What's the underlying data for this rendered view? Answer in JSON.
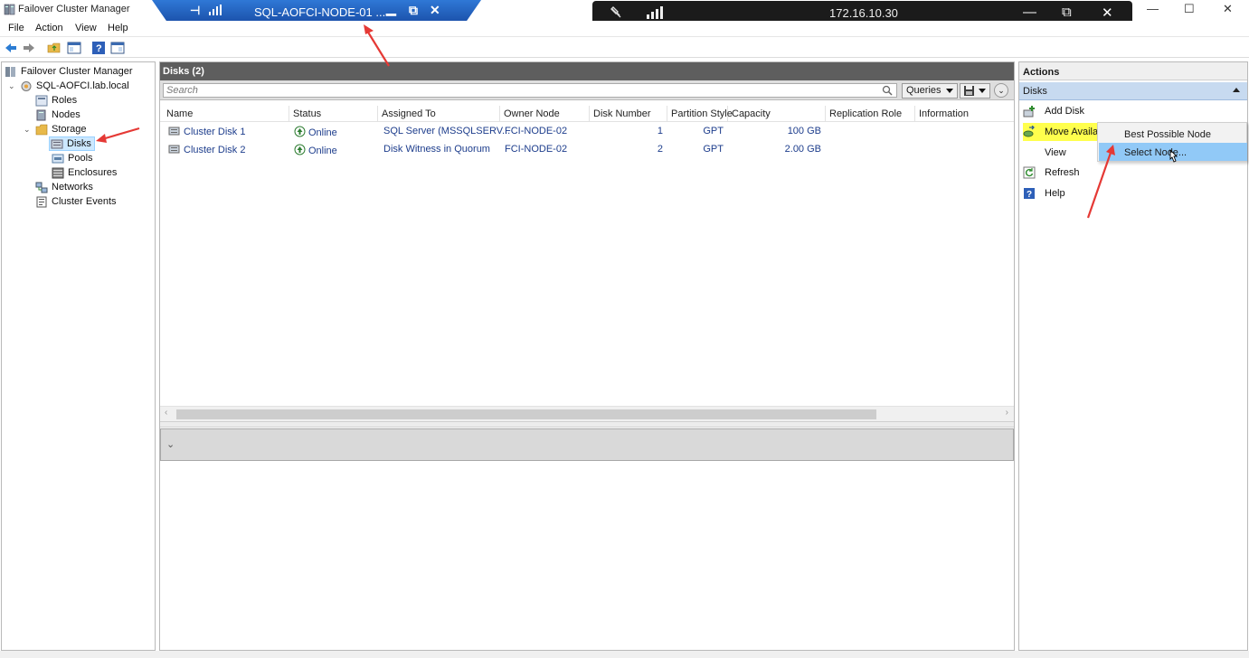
{
  "window": {
    "title": "Failover Cluster Manager",
    "controls": {
      "minimize": "—",
      "maximize": "☐",
      "close": "✕"
    }
  },
  "rdp_bar": {
    "title": "SQL-AOFCI-NODE-01 ...",
    "pin": "⊣",
    "controls": {
      "minimize": "▁",
      "restore": "⧉",
      "close": "✕"
    }
  },
  "remote_bar": {
    "address": "172.16.10.30",
    "controls": {
      "minimize": "—",
      "restore": "⧉",
      "close": "✕"
    }
  },
  "menu": {
    "items": [
      "File",
      "Action",
      "View",
      "Help"
    ]
  },
  "tree": {
    "root": "Failover Cluster Manager",
    "cluster": "SQL-AOFCI.lab.local",
    "roles": "Roles",
    "nodes": "Nodes",
    "storage": "Storage",
    "disks": "Disks",
    "pools": "Pools",
    "enclosures": "Enclosures",
    "networks": "Networks",
    "cluster_events": "Cluster Events"
  },
  "center": {
    "header": "Disks (2)",
    "search_placeholder": "Search",
    "queries_label": "Queries",
    "columns": [
      "Name",
      "Status",
      "Assigned To",
      "Owner Node",
      "Disk Number",
      "Partition Style",
      "Capacity",
      "Replication Role",
      "Information"
    ],
    "rows": [
      {
        "name": "Cluster Disk 1",
        "status": "Online",
        "assigned_to": "SQL Server (MSSQLSERV...",
        "owner_node": "FCI-NODE-02",
        "disk_number": "1",
        "partition_style": "GPT",
        "capacity": "100 GB"
      },
      {
        "name": "Cluster Disk 2",
        "status": "Online",
        "assigned_to": "Disk Witness in Quorum",
        "owner_node": "FCI-NODE-02",
        "disk_number": "2",
        "partition_style": "GPT",
        "capacity": "2.00 GB"
      }
    ]
  },
  "actions": {
    "title": "Actions",
    "section": "Disks",
    "items": [
      "Add Disk",
      "Move Availa",
      "View",
      "Refresh",
      "Help"
    ]
  },
  "submenu": {
    "items": [
      "Best Possible Node",
      "Select Node..."
    ]
  },
  "colors": {
    "header_bg": "#5e5e5e",
    "section_bg": "#c7daf0",
    "highlight_yellow": "#ffff4d",
    "submenu_selected": "#91c9f7",
    "annotation_arrow": "#e53935",
    "rdp_bar": "#1f5fbf"
  }
}
